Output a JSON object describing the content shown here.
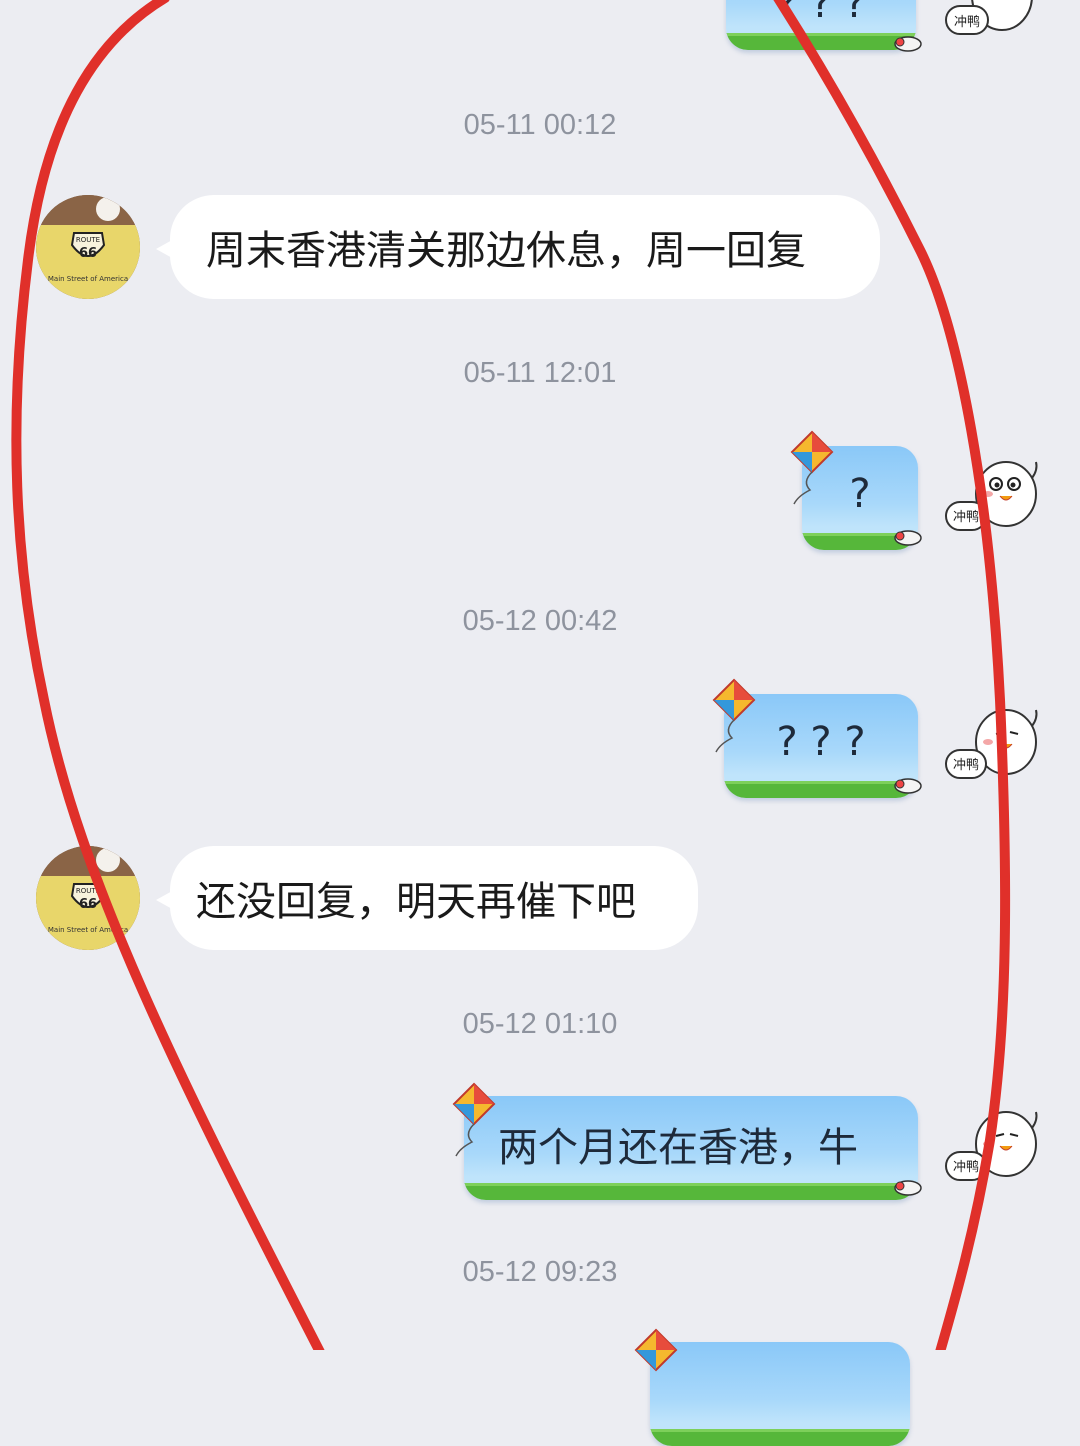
{
  "messages": [
    {
      "kind": "outgoing",
      "text": "? ? ?"
    },
    {
      "kind": "timestamp",
      "text": "05-11 00:12"
    },
    {
      "kind": "incoming",
      "text": "周末香港清关那边休息，周一回复"
    },
    {
      "kind": "timestamp",
      "text": "05-11 12:01"
    },
    {
      "kind": "outgoing",
      "text": "?"
    },
    {
      "kind": "timestamp",
      "text": "05-12 00:42"
    },
    {
      "kind": "outgoing",
      "text": "? ? ?"
    },
    {
      "kind": "incoming",
      "text": "还没回复，明天再催下吧"
    },
    {
      "kind": "timestamp",
      "text": "05-12 01:10"
    },
    {
      "kind": "outgoing",
      "text": "两个月还在香港，牛"
    },
    {
      "kind": "timestamp",
      "text": "05-12 09:23"
    }
  ],
  "avatar_badge": {
    "sign": "ROUTE",
    "number": "66",
    "caption": "Main Street of America"
  },
  "self_avatar_label": "冲鸭",
  "colors": {
    "background": "#ECEDF2",
    "incoming_bubble": "#FFFFFF",
    "outgoing_bubble_top": "#8AC8F8",
    "outgoing_grass": "#56B73A",
    "timestamp_text": "#8E939E",
    "annotation_stroke": "#E53935"
  },
  "icons": [
    "contact-avatar",
    "kite-icon",
    "seal-icon",
    "duck-avatar",
    "red-circle-annotation"
  ]
}
